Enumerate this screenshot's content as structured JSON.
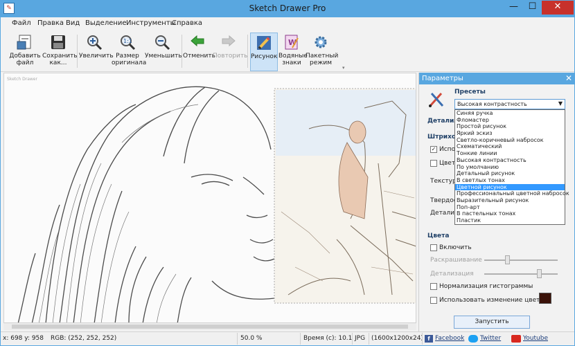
{
  "window": {
    "title": "Sketch Drawer Pro",
    "controls": [
      "—",
      "☐",
      "✕"
    ]
  },
  "menu": [
    "Файл",
    "Правка",
    "Вид",
    "Выделение",
    "Инструменты",
    "Справка"
  ],
  "toolbar": {
    "add": "Добавить файл",
    "save": "Сохранить как...",
    "zoom_in": "Увеличить",
    "orig_size": "Размер оригинала",
    "zoom_out": "Уменьшить",
    "undo": "Отменить",
    "redo": "Повторить",
    "drawing": "Рисунок",
    "watermarks": "Водяные знаки",
    "batch": "Пакетный режим"
  },
  "canvas": {
    "watermark": "Sketch Drawer"
  },
  "panel": {
    "title": "Параметры",
    "presets_label": "Пресеты",
    "selected_preset": "Высокая контрастность",
    "preset_options": [
      "Синяя ручка",
      "Фломастер",
      "Простой рисунок",
      "Яркий эскиз",
      "Светло-коричневый набросок",
      "Схематический",
      "Тонкие линии",
      "Высокая контрастность",
      "По умолчанию",
      "Детальный рисунок",
      "В светлых тонах",
      "Цветной рисунок",
      "Профессиональный цветной набросок",
      "Выразительный рисунок",
      "Поп-арт",
      "В пастельных тонах",
      "Пластик"
    ],
    "highlighted_index": 11,
    "hidden_labels": {
      "detail": "Детализ",
      "strokes": "Штрихов",
      "use": "Испол",
      "color": "Цветн",
      "texture": "Текстура",
      "hardness": "Твердос",
      "detail2": "Детализ"
    },
    "colors_label": "Цвета",
    "enable": "Включить",
    "coloring": "Раскрашивание",
    "detailing": "Детализация",
    "histogram": "Нормализация гистограммы",
    "color_change": "Использовать изменение цвета",
    "run": "Запустить",
    "use_checked": true,
    "color_swatch": "#3b1209"
  },
  "status": {
    "coords": "x: 698 y: 958",
    "rgb": "RGB: (252, 252, 252)",
    "zoom": "50.0 %",
    "time": "Время (с): 10.1",
    "format": "JPG",
    "size": "(1600x1200x24)",
    "facebook": "Facebook",
    "twitter": "Twitter",
    "youtube": "Youtube"
  },
  "colors": {
    "accent": "#59a7e0",
    "selection": "#3399ff",
    "close": "#c7312b"
  }
}
